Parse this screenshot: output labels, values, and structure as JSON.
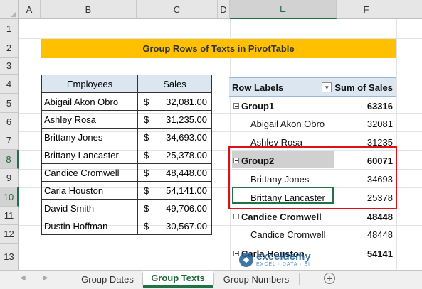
{
  "columns": [
    "A",
    "B",
    "C",
    "D",
    "E",
    "F"
  ],
  "rows": [
    "1",
    "2",
    "3",
    "4",
    "5",
    "6",
    "7",
    "8",
    "9",
    "10",
    "11",
    "12",
    "13"
  ],
  "title": "Group Rows of Texts in PivotTable",
  "table": {
    "headers": [
      "Employees",
      "Sales"
    ],
    "rows": [
      {
        "name": "Abigail Akon Obro",
        "cur": "$",
        "sales": "32,081.00"
      },
      {
        "name": "Ashley Rosa",
        "cur": "$",
        "sales": "31,235.00"
      },
      {
        "name": "Brittany Jones",
        "cur": "$",
        "sales": "34,693.00"
      },
      {
        "name": "Brittany Lancaster",
        "cur": "$",
        "sales": "25,378.00"
      },
      {
        "name": "Candice Cromwell",
        "cur": "$",
        "sales": "48,448.00"
      },
      {
        "name": "Carla Houston",
        "cur": "$",
        "sales": "54,141.00"
      },
      {
        "name": "David Smith",
        "cur": "$",
        "sales": "49,706.00"
      },
      {
        "name": "Dustin Hoffman",
        "cur": "$",
        "sales": "30,567.00"
      }
    ]
  },
  "pivot": {
    "header_labels": "Row Labels",
    "header_sum": "Sum of Sales",
    "rows": [
      {
        "label": "Group1",
        "value": "63316",
        "bold": true,
        "group": true
      },
      {
        "label": "Abigail Akon Obro",
        "value": "32081"
      },
      {
        "label": "Ashley Rosa",
        "value": "31235"
      },
      {
        "label": "Group2",
        "value": "60071",
        "bold": true,
        "group": true
      },
      {
        "label": "Brittany Jones",
        "value": "34693"
      },
      {
        "label": "Brittany Lancaster",
        "value": "25378"
      },
      {
        "label": "Candice Cromwell",
        "value": "48448",
        "bold": true,
        "group": true
      },
      {
        "label": "Candice Cromwell",
        "value": "48448"
      },
      {
        "label": "Carla Houston",
        "value": "54141",
        "bold": true,
        "group": true
      }
    ]
  },
  "tabs": [
    "Group Dates",
    "Group Texts",
    "Group Numbers"
  ],
  "active_tab": "Group Texts",
  "watermark": {
    "name": "exceldemy",
    "tagline": "EXCEL · DATA · BI"
  },
  "accent": "#217346",
  "highlight_color": "#e0101a"
}
